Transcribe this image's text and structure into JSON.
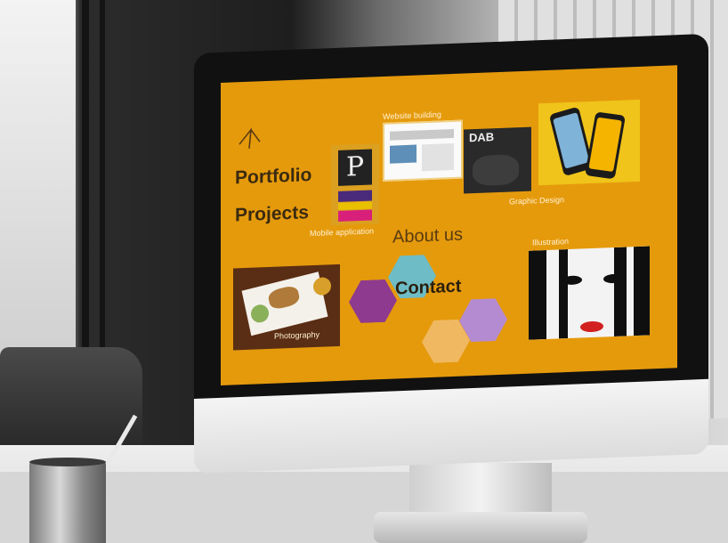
{
  "screen": {
    "brand_color": "#e59a0c",
    "logo_icon": "hanger-icon",
    "portfolio_label": "Portfolio",
    "projects_label": "Projects",
    "about_label": "About us",
    "contact_label": "Contact"
  },
  "tiles": {
    "mobile_app": {
      "label": "Mobile application",
      "icon_letter": "P"
    },
    "website": {
      "label": "Website building"
    },
    "graphic": {
      "label": "Graphic Design",
      "title": "DAB"
    },
    "photography": {
      "label": "Photography"
    },
    "illustration": {
      "label": "Illustration"
    }
  },
  "hexagons": {
    "colors": [
      "#6dbcc6",
      "#8e3a8e",
      "#b48ad0",
      "#f0b860"
    ]
  }
}
